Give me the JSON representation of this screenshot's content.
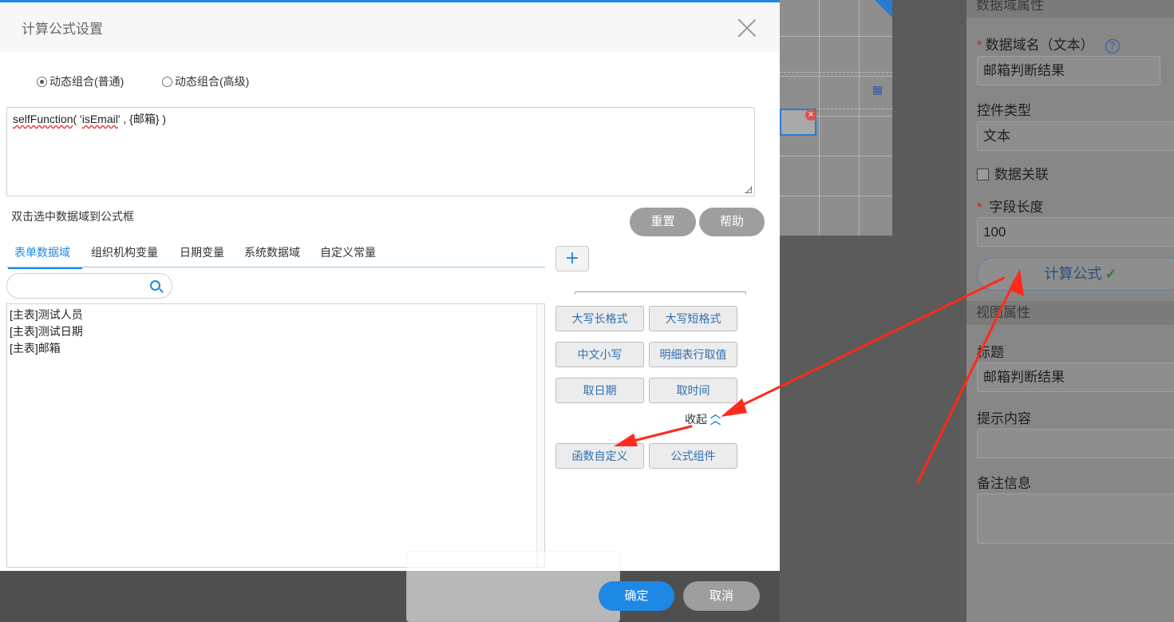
{
  "modal": {
    "title": "计算公式设置",
    "mode_options": [
      {
        "label": "动态组合(普通)",
        "selected": true
      },
      {
        "label": "动态组合(高级)",
        "selected": false
      }
    ],
    "formula": {
      "func_name": "selfFunction",
      "open": "( '",
      "arg": "isEmail",
      "rest": "' , {邮箱} )"
    },
    "hint": "双击选中数据域到公式框",
    "reset_label": "重置",
    "help_label": "帮助",
    "tabs": [
      "表单数据域",
      "组织机构变量",
      "日期变量",
      "系统数据域",
      "自定义常量"
    ],
    "search": {
      "value": "",
      "placeholder": ""
    },
    "fields": [
      "[主表]测试人员",
      "[主表]测试日期",
      "[主表]邮箱"
    ],
    "add_label": "+",
    "function_buttons": [
      "大写长格式",
      "大写短格式",
      "中文小写",
      "明细表行取值",
      "取日期",
      "取时间"
    ],
    "collapse_label": "收起",
    "custom_buttons": [
      "函数自定义",
      "公式组件"
    ],
    "ok_label": "确定",
    "cancel_label": "取消"
  },
  "property_panel": {
    "section_data": "数据域属性",
    "field_name_label": "数据域名（文本）",
    "field_name_value": "邮箱判断结果",
    "control_type_label": "控件类型",
    "control_type_value": "文本",
    "data_link_label": "数据关联",
    "field_length_label": "字段长度",
    "field_length_value": "100",
    "formula_button_label": "计算公式",
    "section_view": "视图属性",
    "title_label": "标题",
    "title_value": "邮箱判断结果",
    "tip_label": "提示内容",
    "tip_value": "",
    "remark_label": "备注信息",
    "remark_value": ""
  },
  "colors": {
    "accent": "#1e88e5",
    "annotation_arrow": "#ff2a1a",
    "required": "#c62828"
  },
  "icons": [
    "close-icon",
    "search-icon",
    "plus-icon",
    "double-chevron-up-icon",
    "help-icon",
    "checkmark-icon",
    "calendar-icon",
    "remove-icon"
  ]
}
